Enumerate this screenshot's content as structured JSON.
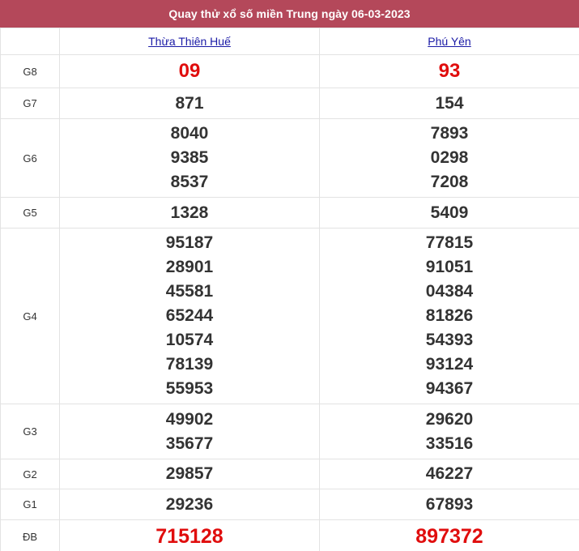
{
  "header": {
    "title": "Quay thử xổ số miền Trung ngày 06-03-2023"
  },
  "provinces": [
    {
      "name": "Thừa Thiên Huế"
    },
    {
      "name": "Phú Yên"
    }
  ],
  "colors": {
    "title_bg": "#b4485a",
    "special_red": "#e00d0d",
    "link_blue": "#1a1aa6"
  },
  "prizes": {
    "g8": {
      "label": "G8",
      "p1": [
        "09"
      ],
      "p2": [
        "93"
      ]
    },
    "g7": {
      "label": "G7",
      "p1": [
        "871"
      ],
      "p2": [
        "154"
      ]
    },
    "g6": {
      "label": "G6",
      "p1": [
        "8040",
        "9385",
        "8537"
      ],
      "p2": [
        "7893",
        "0298",
        "7208"
      ]
    },
    "g5": {
      "label": "G5",
      "p1": [
        "1328"
      ],
      "p2": [
        "5409"
      ]
    },
    "g4": {
      "label": "G4",
      "p1": [
        "95187",
        "28901",
        "45581",
        "65244",
        "10574",
        "78139",
        "55953"
      ],
      "p2": [
        "77815",
        "91051",
        "04384",
        "81826",
        "54393",
        "93124",
        "94367"
      ]
    },
    "g3": {
      "label": "G3",
      "p1": [
        "49902",
        "35677"
      ],
      "p2": [
        "29620",
        "33516"
      ]
    },
    "g2": {
      "label": "G2",
      "p1": [
        "29857"
      ],
      "p2": [
        "46227"
      ]
    },
    "g1": {
      "label": "G1",
      "p1": [
        "29236"
      ],
      "p2": [
        "67893"
      ]
    },
    "db": {
      "label": "ĐB",
      "p1": [
        "715128"
      ],
      "p2": [
        "897372"
      ]
    }
  }
}
